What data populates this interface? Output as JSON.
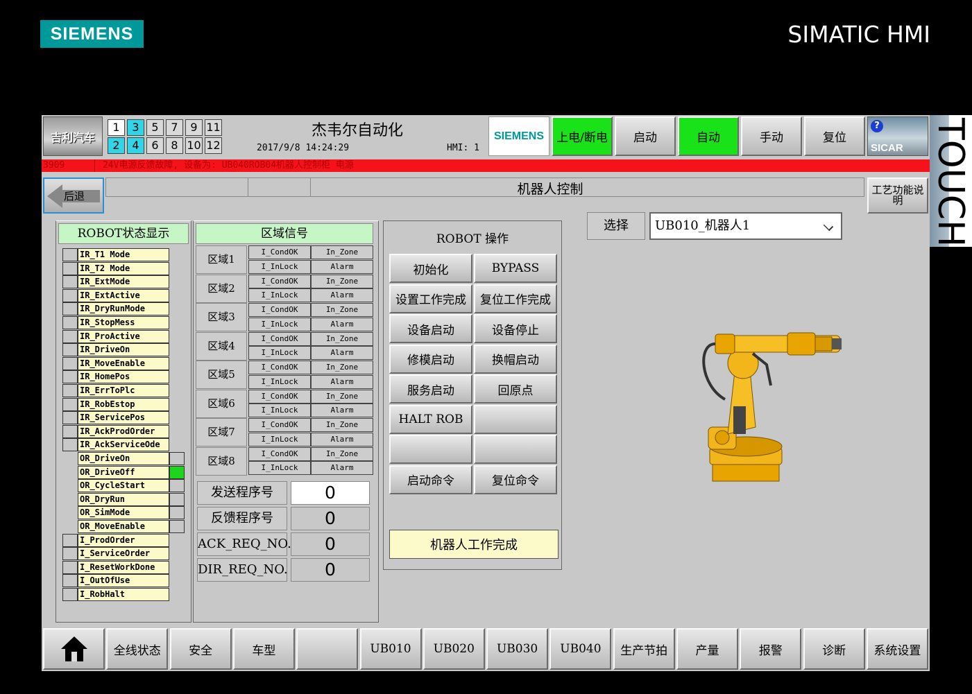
{
  "frame": {
    "brand": "SIEMENS",
    "product": "SIMATIC HMI",
    "touch": "TOUCH"
  },
  "header": {
    "logo_text": "吉利汽车",
    "station_numbers": [
      {
        "n": "1",
        "style": "white"
      },
      {
        "n": "3",
        "style": "cyan"
      },
      {
        "n": "5",
        "style": "grey"
      },
      {
        "n": "7",
        "style": "grey"
      },
      {
        "n": "9",
        "style": "grey"
      },
      {
        "n": "11",
        "style": "grey"
      },
      {
        "n": "2",
        "style": "cyan"
      },
      {
        "n": "4",
        "style": "cyan"
      },
      {
        "n": "6",
        "style": "grey"
      },
      {
        "n": "8",
        "style": "grey"
      },
      {
        "n": "10",
        "style": "grey"
      },
      {
        "n": "12",
        "style": "grey"
      }
    ],
    "company": "杰韦尔自动化",
    "datetime": "2017/9/8 14:24:29",
    "hmi": "HMI: 1",
    "siemens_small": "SIEMENS",
    "buttons": [
      {
        "label": "上电/断电",
        "active": true
      },
      {
        "label": "启动",
        "active": false
      },
      {
        "label": "自动",
        "active": true
      },
      {
        "label": "手动",
        "active": false
      },
      {
        "label": "复位",
        "active": false
      }
    ],
    "sicar": "SICAR",
    "help": "?"
  },
  "alarm": {
    "id": "3909",
    "message": "24V电源反馈故障, 设备为: UB040ROB04机器人控制柜 电源"
  },
  "nav": {
    "back": "后退",
    "title": "机器人控制",
    "craft": "工艺功能说明"
  },
  "status": {
    "title": "ROBOT状态显示",
    "items": [
      {
        "label": "IR_T1 Mode",
        "side": "left"
      },
      {
        "label": "IR_T2 Mode",
        "side": "left"
      },
      {
        "label": "IR_ExtMode",
        "side": "left"
      },
      {
        "label": "IR_ExtActive",
        "side": "left"
      },
      {
        "label": "IR_DryRunMode",
        "side": "left"
      },
      {
        "label": "IR_StopMess",
        "side": "left"
      },
      {
        "label": "IR_ProActive",
        "side": "left"
      },
      {
        "label": "IR_DriveOn",
        "side": "left"
      },
      {
        "label": "IR_MoveEnable",
        "side": "left"
      },
      {
        "label": "IR_HomePos",
        "side": "left"
      },
      {
        "label": "IR_ErrToPlc",
        "side": "left"
      },
      {
        "label": "IR_RobEstop",
        "side": "left"
      },
      {
        "label": "IR_ServicePos",
        "side": "left"
      },
      {
        "label": "IR_AckProdOrder",
        "side": "left"
      },
      {
        "label": "IR_AckServiceOde",
        "side": "left"
      },
      {
        "label": "OR_DriveOn",
        "side": "right"
      },
      {
        "label": "OR_DriveOff",
        "side": "right",
        "on": true
      },
      {
        "label": "OR_CycleStart",
        "side": "right"
      },
      {
        "label": "OR_DryRun",
        "side": "right"
      },
      {
        "label": "OR_SimMode",
        "side": "right"
      },
      {
        "label": "OR_MoveEnable",
        "side": "right"
      },
      {
        "label": "I_ProdOrder",
        "side": "left"
      },
      {
        "label": "I_ServiceOrder",
        "side": "left"
      },
      {
        "label": "I_ResetWorkDone",
        "side": "left"
      },
      {
        "label": "I_OutOfUse",
        "side": "left"
      },
      {
        "label": "I_RobHalt",
        "side": "left"
      }
    ]
  },
  "zones": {
    "title": "区域信号",
    "rows": [
      {
        "label": "区域1",
        "c1": "I_CondOK",
        "c2": "In_Zone",
        "c3": "I_InLock",
        "c4": "Alarm"
      },
      {
        "label": "区域2",
        "c1": "I_CondOK",
        "c2": "In_Zone",
        "c3": "I_InLock",
        "c4": "Alarm"
      },
      {
        "label": "区域3",
        "c1": "I_CondOK",
        "c2": "In_Zone",
        "c3": "I_InLock",
        "c4": "Alarm"
      },
      {
        "label": "区域4",
        "c1": "I_CondOK",
        "c2": "In_Zone",
        "c3": "I_InLock",
        "c4": "Alarm"
      },
      {
        "label": "区域5",
        "c1": "I_CondOK",
        "c2": "In_Zone",
        "c3": "I_InLock",
        "c4": "Alarm"
      },
      {
        "label": "区域6",
        "c1": "I_CondOK",
        "c2": "In_Zone",
        "c3": "I_InLock",
        "c4": "Alarm"
      },
      {
        "label": "区域7",
        "c1": "I_CondOK",
        "c2": "In_Zone",
        "c3": "I_InLock",
        "c4": "Alarm"
      },
      {
        "label": "区域8",
        "c1": "I_CondOK",
        "c2": "In_Zone",
        "c3": "I_InLock",
        "c4": "Alarm"
      }
    ],
    "programs": [
      {
        "label": "发送程序号",
        "value": "0",
        "editable": true
      },
      {
        "label": "反馈程序号",
        "value": "0",
        "editable": false
      },
      {
        "label": "ACK_REQ_NO.",
        "value": "0",
        "editable": false
      },
      {
        "label": "DIR_REQ_NO.",
        "value": "0",
        "editable": false
      }
    ]
  },
  "operations": {
    "title": "ROBOT 操作",
    "buttons": [
      "初始化",
      "BYPASS",
      "设置工作完成",
      "复位工作完成",
      "设备启动",
      "设备停止",
      "修模启动",
      "换帽启动",
      "服务启动",
      "回原点",
      "HALT ROB",
      "",
      "",
      "",
      "启动命令",
      "复位命令"
    ],
    "done": "机器人工作完成"
  },
  "selector": {
    "label": "选择",
    "value": "UB010_机器人1"
  },
  "footer": [
    "",
    "全线状态",
    "安全",
    "车型",
    "",
    "UB010",
    "UB020",
    "UB030",
    "UB040",
    "生产节拍",
    "产量",
    "报警",
    "诊断",
    "系统设置"
  ]
}
